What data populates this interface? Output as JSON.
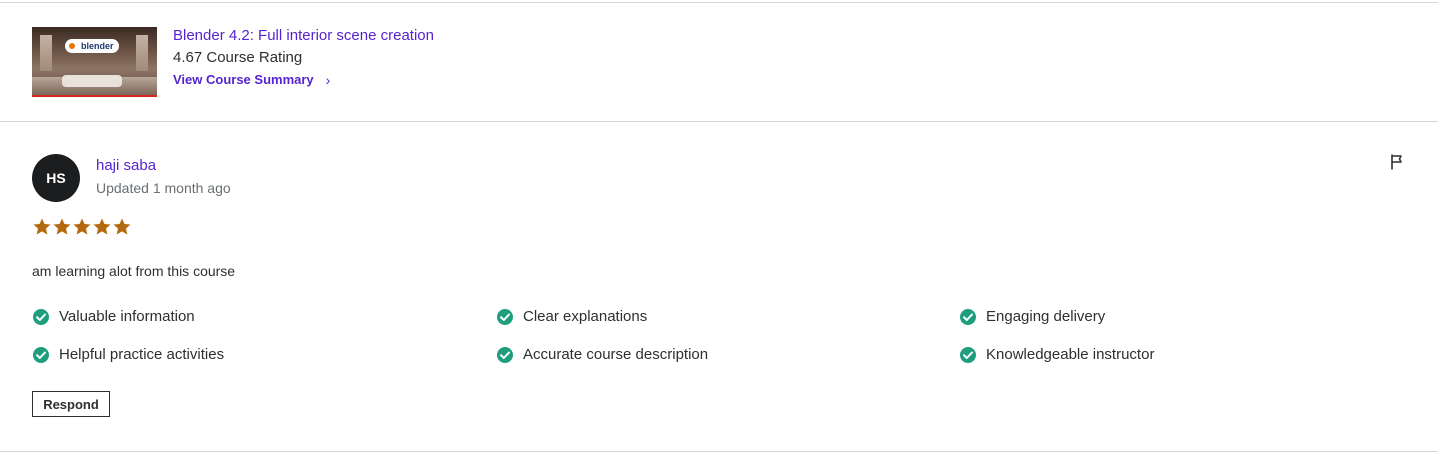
{
  "course": {
    "title": "Blender 4.2: Full interior scene creation",
    "rating": "4.67 Course Rating",
    "summary_link": "View Course Summary",
    "thumbnail_logo_text": "blender"
  },
  "review": {
    "avatar_initials": "HS",
    "reviewer_name": "haji saba",
    "updated": "Updated 1 month ago",
    "rating_stars": 5,
    "text": "am learning alot from this course",
    "tags": [
      "Valuable information",
      "Clear explanations",
      "Engaging delivery",
      "Helpful practice activities",
      "Accurate course description",
      "Knowledgeable instructor"
    ],
    "respond_label": "Respond"
  },
  "colors": {
    "link": "#5624d0",
    "star": "#b4690e",
    "check": "#1e9e7e",
    "avatar_bg": "#1c1d1f"
  },
  "icons": {
    "flag": "flag-icon",
    "chevron": "chevron-right-icon",
    "check": "check-circle-icon",
    "star": "star-icon"
  }
}
